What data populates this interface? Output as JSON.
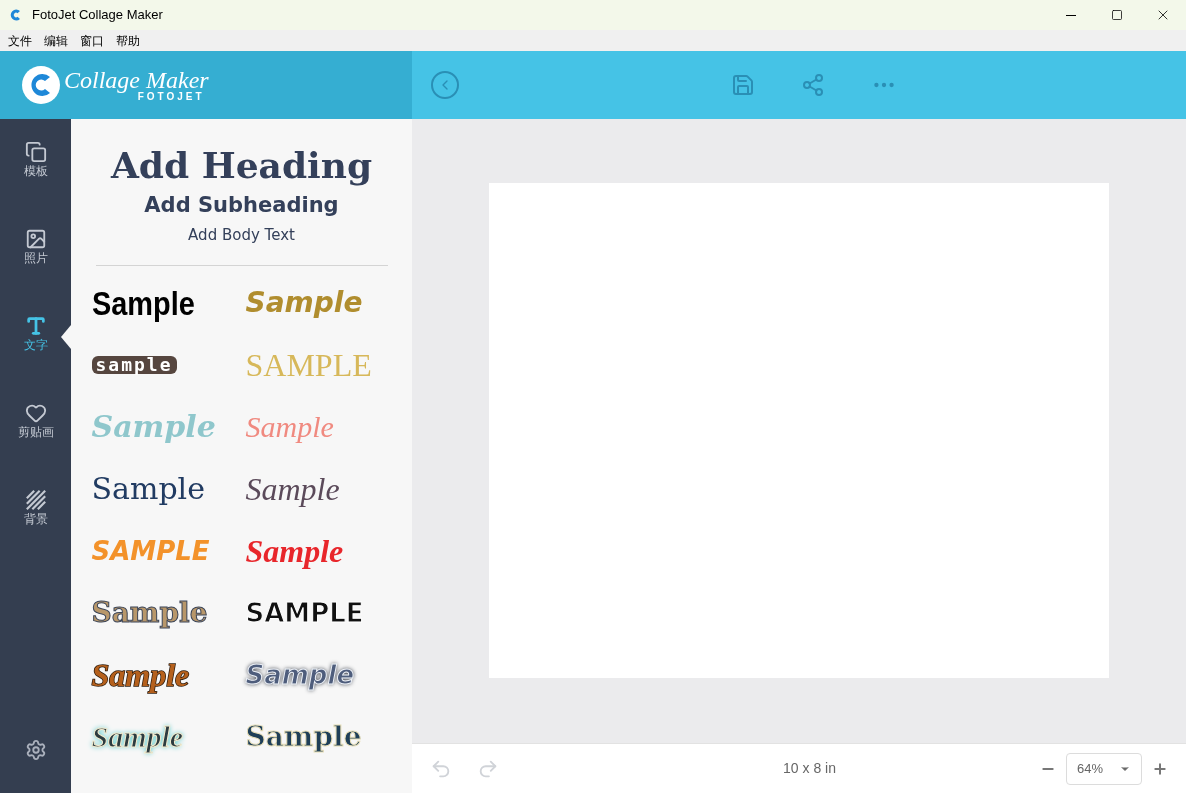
{
  "window": {
    "title": "FotoJet Collage Maker"
  },
  "menu": [
    "文件",
    "编辑",
    "窗口",
    "帮助"
  ],
  "logo": {
    "script": "Collage Maker",
    "brand": "FOTOJET"
  },
  "sidebar": [
    {
      "kind": "templates",
      "label": "模板",
      "selected": false
    },
    {
      "kind": "photos",
      "label": "照片",
      "selected": false
    },
    {
      "kind": "text",
      "label": "文字",
      "selected": true
    },
    {
      "kind": "clipart",
      "label": "剪贴画",
      "selected": false
    },
    {
      "kind": "background",
      "label": "背景",
      "selected": false
    }
  ],
  "text_panel": {
    "heading": "Add Heading",
    "subheading": "Add Subheading",
    "body": "Add Body Text",
    "samples": [
      {
        "kind": "bold-black",
        "text": "Sample"
      },
      {
        "kind": "gold-italic",
        "text": "Sample"
      },
      {
        "kind": "tiles",
        "text": "sample"
      },
      {
        "kind": "serif-gold",
        "text": "SAMPLE"
      },
      {
        "kind": "teal-script",
        "text": "Sample"
      },
      {
        "kind": "pink-script",
        "text": "Sample"
      },
      {
        "kind": "navy-rough",
        "text": "Sample"
      },
      {
        "kind": "thin-script",
        "text": "Sample"
      },
      {
        "kind": "orange-brush",
        "text": "SAMPLE"
      },
      {
        "kind": "red-script",
        "text": "Sample"
      },
      {
        "kind": "tan-outline",
        "text": "Sample"
      },
      {
        "kind": "white-black-outline",
        "text": "SAMPLE"
      },
      {
        "kind": "brown-script",
        "text": "Sample"
      },
      {
        "kind": "slate-glow",
        "text": "Sample"
      },
      {
        "kind": "cream-teal-glow",
        "text": "Sample"
      },
      {
        "kind": "navy-cream-outline",
        "text": "Sample"
      }
    ]
  },
  "canvas": {
    "size": "10 x 8 in",
    "zoom": "64%"
  }
}
